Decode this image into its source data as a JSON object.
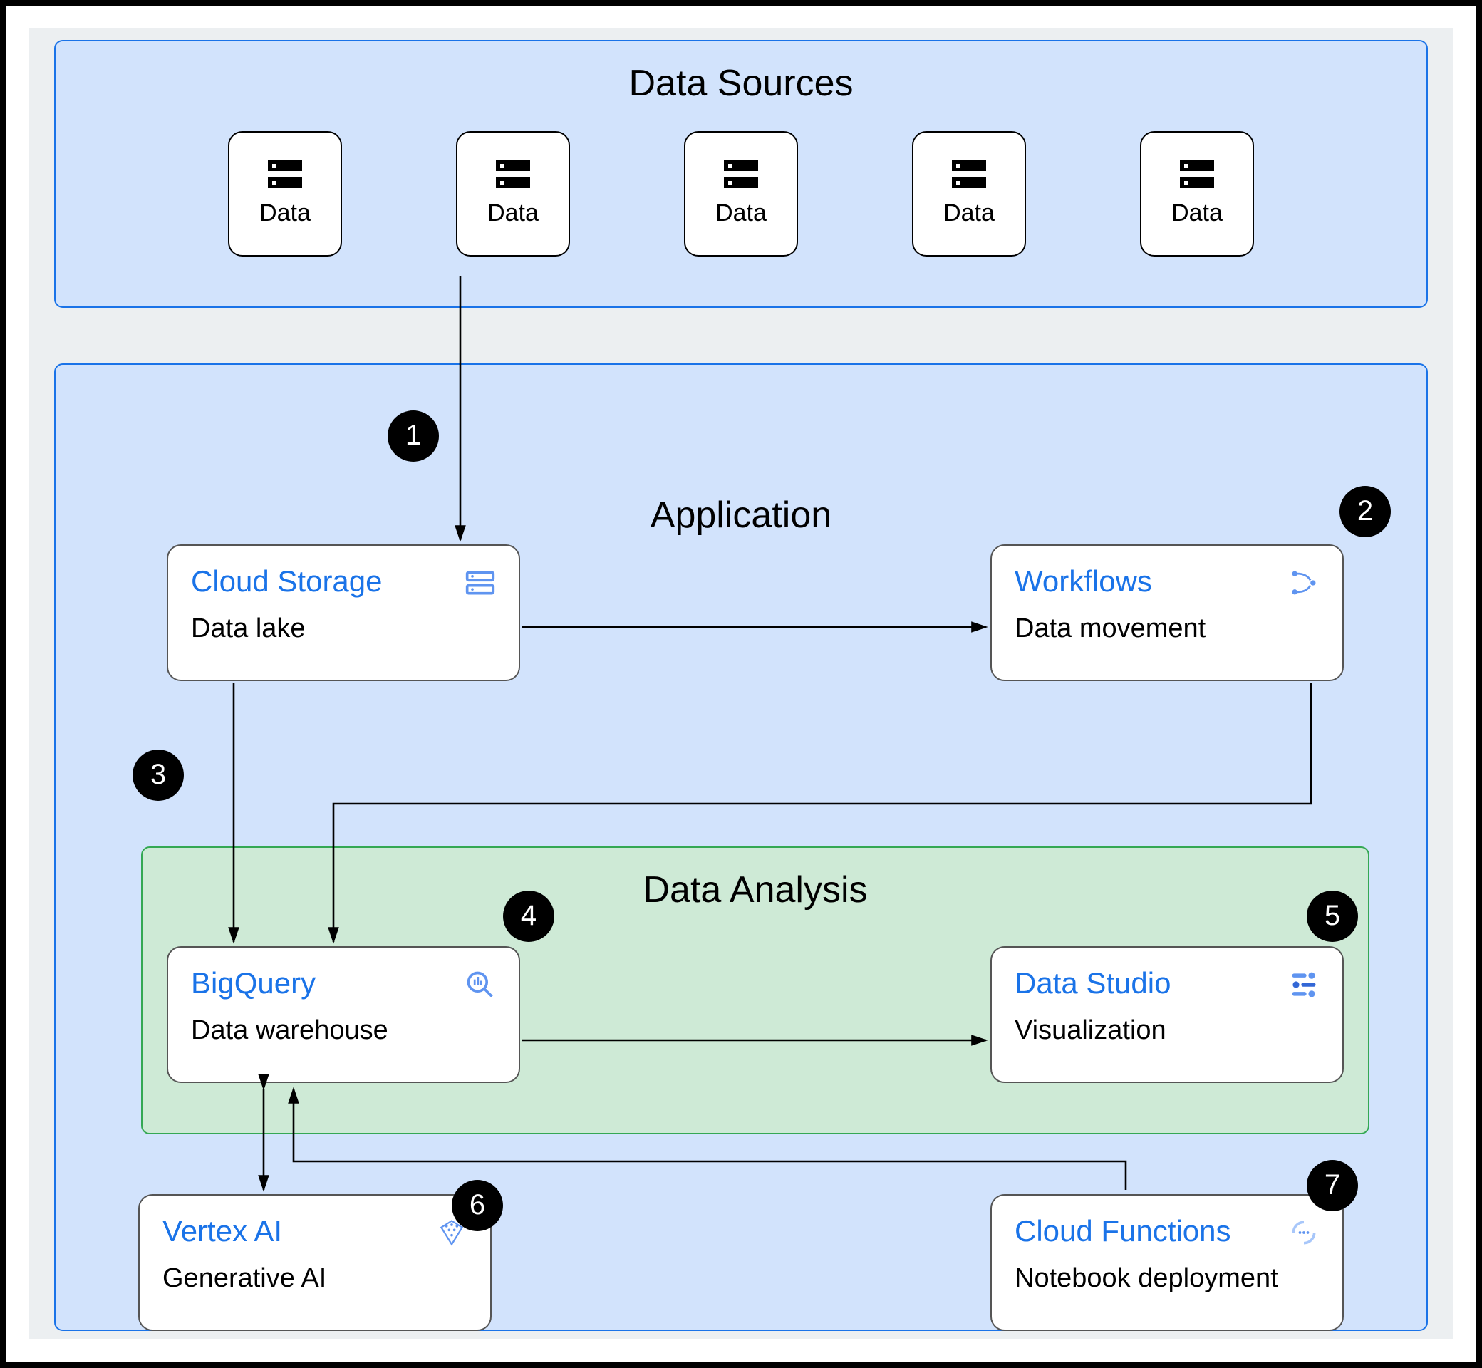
{
  "sections": {
    "sources": {
      "title": "Data Sources"
    },
    "application": {
      "title": "Application"
    },
    "analysis": {
      "title": "Data Analysis"
    }
  },
  "data_item_label": "Data",
  "services": {
    "storage": {
      "title": "Cloud Storage",
      "subtitle": "Data lake"
    },
    "workflows": {
      "title": "Workflows",
      "subtitle": "Data movement"
    },
    "bigquery": {
      "title": "BigQuery",
      "subtitle": "Data warehouse"
    },
    "dstudio": {
      "title": "Data Studio",
      "subtitle": "Visualization"
    },
    "vertex": {
      "title": "Vertex AI",
      "subtitle": "Generative AI"
    },
    "functions": {
      "title": "Cloud Functions",
      "subtitle": "Notebook deployment"
    }
  },
  "badges": [
    "1",
    "2",
    "3",
    "4",
    "5",
    "6",
    "7"
  ]
}
